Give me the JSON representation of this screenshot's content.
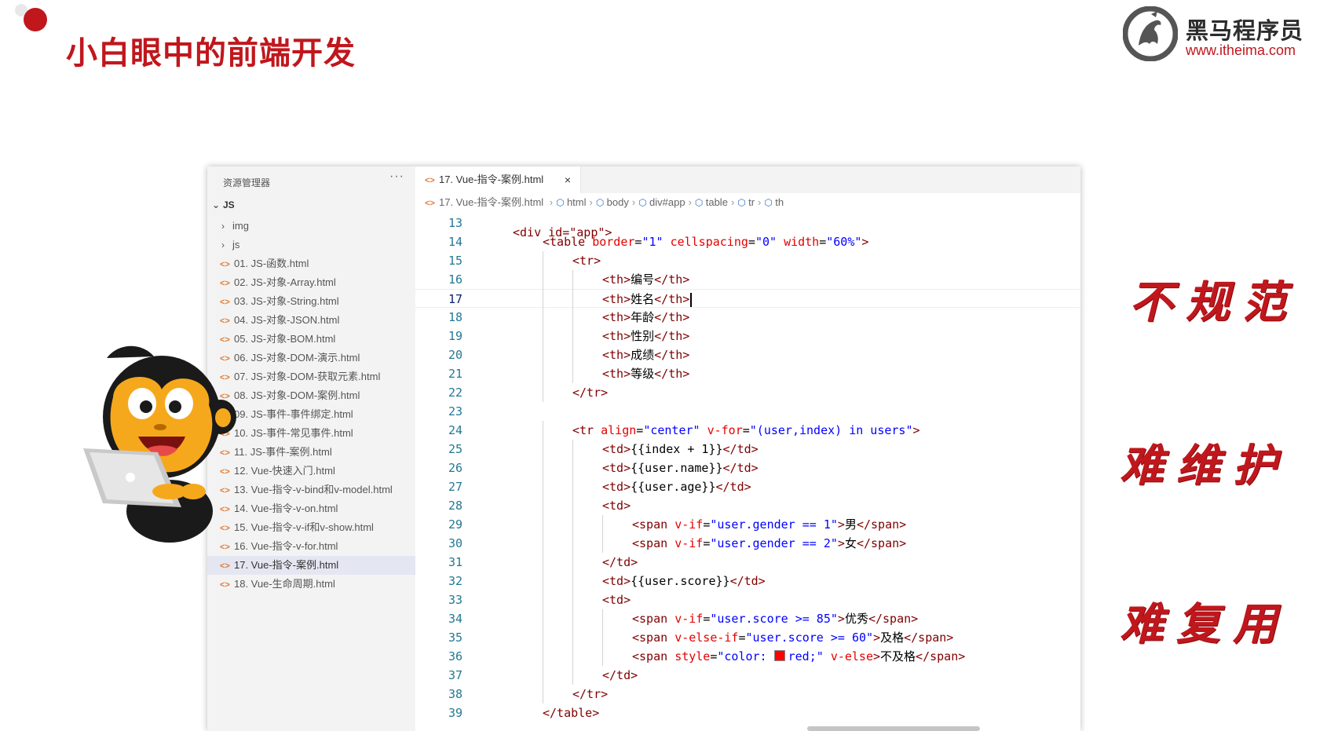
{
  "slide": {
    "title": "小白眼中的前端开发",
    "logo_name": "黑马程序员",
    "logo_url": "www.itheima.com"
  },
  "explorer": {
    "header": "资源管理器",
    "more": "···",
    "root": "JS",
    "folders": [
      "img",
      "js"
    ],
    "files": [
      "01. JS-函数.html",
      "02. JS-对象-Array.html",
      "03. JS-对象-String.html",
      "04. JS-对象-JSON.html",
      "05. JS-对象-BOM.html",
      "06. JS-对象-DOM-演示.html",
      "07. JS-对象-DOM-获取元素.html",
      "08. JS-对象-DOM-案例.html",
      "09. JS-事件-事件绑定.html",
      "10. JS-事件-常见事件.html",
      "11. JS-事件-案例.html",
      "12. Vue-快速入门.html",
      "13. Vue-指令-v-bind和v-model.html",
      "14. Vue-指令-v-on.html",
      "15. Vue-指令-v-if和v-show.html",
      "16. Vue-指令-v-for.html",
      "17. Vue-指令-案例.html",
      "18. Vue-生命周期.html"
    ],
    "active_index": 16
  },
  "tab": {
    "label": "17. Vue-指令-案例.html",
    "close": "×"
  },
  "breadcrumb": {
    "file": "17. Vue-指令-案例.html",
    "items": [
      "html",
      "body",
      "div#app",
      "table",
      "tr",
      "th"
    ]
  },
  "code": {
    "current_line": 17,
    "partial_top": "<div id=\"app\">",
    "lines": [
      {
        "n": "13"
      },
      {
        "n": "14",
        "indent": 2,
        "parts": [
          [
            "tag",
            "<table "
          ],
          [
            "attr",
            "border"
          ],
          [
            "txt",
            "="
          ],
          [
            "str",
            "\"1\""
          ],
          [
            "tag",
            " "
          ],
          [
            "attr",
            "cellspacing"
          ],
          [
            "txt",
            "="
          ],
          [
            "str",
            "\"0\""
          ],
          [
            "tag",
            " "
          ],
          [
            "attr",
            "width"
          ],
          [
            "txt",
            "="
          ],
          [
            "str",
            "\"60%\""
          ],
          [
            "tag",
            ">"
          ]
        ]
      },
      {
        "n": "15",
        "indent": 3,
        "parts": [
          [
            "tag",
            "<tr>"
          ]
        ]
      },
      {
        "n": "16",
        "indent": 4,
        "parts": [
          [
            "tag",
            "<th>"
          ],
          [
            "txt",
            "编号"
          ],
          [
            "tag",
            "</th>"
          ]
        ]
      },
      {
        "n": "17",
        "indent": 4,
        "parts": [
          [
            "tag",
            "<th>"
          ],
          [
            "txt",
            "姓名"
          ],
          [
            "tag",
            "</th>"
          ]
        ],
        "caret": true
      },
      {
        "n": "18",
        "indent": 4,
        "parts": [
          [
            "tag",
            "<th>"
          ],
          [
            "txt",
            "年龄"
          ],
          [
            "tag",
            "</th>"
          ]
        ]
      },
      {
        "n": "19",
        "indent": 4,
        "parts": [
          [
            "tag",
            "<th>"
          ],
          [
            "txt",
            "性别"
          ],
          [
            "tag",
            "</th>"
          ]
        ]
      },
      {
        "n": "20",
        "indent": 4,
        "parts": [
          [
            "tag",
            "<th>"
          ],
          [
            "txt",
            "成绩"
          ],
          [
            "tag",
            "</th>"
          ]
        ]
      },
      {
        "n": "21",
        "indent": 4,
        "parts": [
          [
            "tag",
            "<th>"
          ],
          [
            "txt",
            "等级"
          ],
          [
            "tag",
            "</th>"
          ]
        ]
      },
      {
        "n": "22",
        "indent": 3,
        "parts": [
          [
            "tag",
            "</tr>"
          ]
        ]
      },
      {
        "n": "23"
      },
      {
        "n": "24",
        "indent": 3,
        "parts": [
          [
            "tag",
            "<tr "
          ],
          [
            "attr",
            "align"
          ],
          [
            "txt",
            "="
          ],
          [
            "str",
            "\"center\""
          ],
          [
            "tag",
            " "
          ],
          [
            "attr",
            "v-for"
          ],
          [
            "txt",
            "="
          ],
          [
            "str",
            "\"(user,index) in users\""
          ],
          [
            "tag",
            ">"
          ]
        ]
      },
      {
        "n": "25",
        "indent": 4,
        "parts": [
          [
            "tag",
            "<td>"
          ],
          [
            "txt",
            "{{index + 1}}"
          ],
          [
            "tag",
            "</td>"
          ]
        ]
      },
      {
        "n": "26",
        "indent": 4,
        "parts": [
          [
            "tag",
            "<td>"
          ],
          [
            "txt",
            "{{user.name}}"
          ],
          [
            "tag",
            "</td>"
          ]
        ]
      },
      {
        "n": "27",
        "indent": 4,
        "parts": [
          [
            "tag",
            "<td>"
          ],
          [
            "txt",
            "{{user.age}}"
          ],
          [
            "tag",
            "</td>"
          ]
        ]
      },
      {
        "n": "28",
        "indent": 4,
        "parts": [
          [
            "tag",
            "<td>"
          ]
        ]
      },
      {
        "n": "29",
        "indent": 5,
        "parts": [
          [
            "tag",
            "<span "
          ],
          [
            "attr",
            "v-if"
          ],
          [
            "txt",
            "="
          ],
          [
            "str",
            "\"user.gender == 1\""
          ],
          [
            "tag",
            ">"
          ],
          [
            "txt",
            "男"
          ],
          [
            "tag",
            "</span>"
          ]
        ]
      },
      {
        "n": "30",
        "indent": 5,
        "parts": [
          [
            "tag",
            "<span "
          ],
          [
            "attr",
            "v-if"
          ],
          [
            "txt",
            "="
          ],
          [
            "str",
            "\"user.gender == 2\""
          ],
          [
            "tag",
            ">"
          ],
          [
            "txt",
            "女"
          ],
          [
            "tag",
            "</span>"
          ]
        ]
      },
      {
        "n": "31",
        "indent": 4,
        "parts": [
          [
            "tag",
            "</td>"
          ]
        ]
      },
      {
        "n": "32",
        "indent": 4,
        "parts": [
          [
            "tag",
            "<td>"
          ],
          [
            "txt",
            "{{user.score}}"
          ],
          [
            "tag",
            "</td>"
          ]
        ]
      },
      {
        "n": "33",
        "indent": 4,
        "parts": [
          [
            "tag",
            "<td>"
          ]
        ]
      },
      {
        "n": "34",
        "indent": 5,
        "parts": [
          [
            "tag",
            "<span "
          ],
          [
            "attr",
            "v-if"
          ],
          [
            "txt",
            "="
          ],
          [
            "str",
            "\"user.score >= 85\""
          ],
          [
            "tag",
            ">"
          ],
          [
            "txt",
            "优秀"
          ],
          [
            "tag",
            "</span>"
          ]
        ]
      },
      {
        "n": "35",
        "indent": 5,
        "parts": [
          [
            "tag",
            "<span "
          ],
          [
            "attr",
            "v-else-if"
          ],
          [
            "txt",
            "="
          ],
          [
            "str",
            "\"user.score >= 60\""
          ],
          [
            "tag",
            ">"
          ],
          [
            "txt",
            "及格"
          ],
          [
            "tag",
            "</span>"
          ]
        ]
      },
      {
        "n": "36",
        "indent": 5,
        "parts": [
          [
            "tag",
            "<span "
          ],
          [
            "attr",
            "style"
          ],
          [
            "txt",
            "="
          ],
          [
            "str",
            "\"color: "
          ],
          [
            "swatch",
            ""
          ],
          [
            "str",
            "red;\""
          ],
          [
            "tag",
            " "
          ],
          [
            "attr",
            "v-else"
          ],
          [
            "tag",
            ">"
          ],
          [
            "txt",
            "不及格"
          ],
          [
            "tag",
            "</span>"
          ]
        ]
      },
      {
        "n": "37",
        "indent": 4,
        "parts": [
          [
            "tag",
            "</td>"
          ]
        ]
      },
      {
        "n": "38",
        "indent": 3,
        "parts": [
          [
            "tag",
            "</tr>"
          ]
        ]
      },
      {
        "n": "39",
        "indent": 2,
        "parts": [
          [
            "tag",
            "</table>"
          ]
        ]
      }
    ]
  },
  "notes": [
    "不规范",
    "难维护",
    "难复用"
  ],
  "colors": {
    "brand_red": "#c0171d",
    "tag": "#800000",
    "attr": "#e50000",
    "string": "#0000ff",
    "line_number": "#237893"
  }
}
